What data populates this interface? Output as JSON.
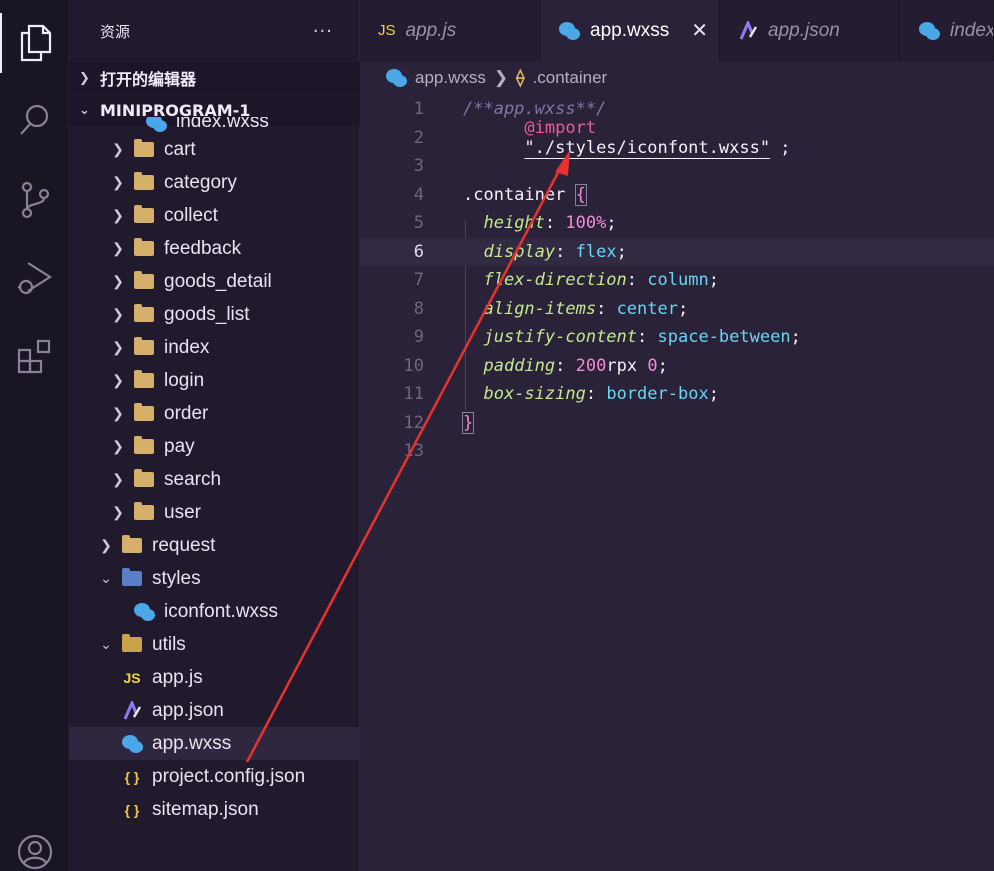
{
  "sidebar": {
    "title": "资源",
    "more": "···",
    "section_open_editors": "打开的编辑器",
    "section_project": "MINIPROGRAM-1",
    "partial_item": "index.wxss",
    "pages": [
      "cart",
      "category",
      "collect",
      "feedback",
      "goods_detail",
      "goods_list",
      "index",
      "login",
      "order",
      "pay",
      "search",
      "user"
    ],
    "request": "request",
    "styles": "styles",
    "iconfont": "iconfont.wxss",
    "utils": "utils",
    "appjs": "app.js",
    "appjson": "app.json",
    "appwxss": "app.wxss",
    "project_config": "project.config.json",
    "sitemap": "sitemap.json"
  },
  "tabs": [
    {
      "label": "app.js",
      "icon": "js-icon"
    },
    {
      "label": "app.wxss",
      "icon": "wechat-icon",
      "close": "✕"
    },
    {
      "label": "app.json",
      "icon": "json-icon"
    },
    {
      "label": "index",
      "icon": "wechat-icon"
    }
  ],
  "breadcrumb": {
    "file": "app.wxss",
    "symbol": ".container"
  },
  "editor": {
    "line_numbers": [
      "1",
      "2",
      "3",
      "4",
      "5",
      "6",
      "7",
      "8",
      "9",
      "10",
      "11",
      "12",
      "13"
    ],
    "comment": "/**app.wxss**/",
    "import_kw": "@import",
    "import_path": "\"./styles/iconfont.wxss\"",
    "semicolon": " ;",
    "selector": ".container ",
    "open_brace": "{",
    "close_brace": "}",
    "props": [
      {
        "name": "height",
        "value_num": "100",
        "value_unit": "%",
        "value": ""
      },
      {
        "name": "display",
        "value": "flex"
      },
      {
        "name": "flex-direction",
        "value": "column"
      },
      {
        "name": "align-items",
        "value": "center"
      },
      {
        "name": "justify-content",
        "value": "space-between"
      },
      {
        "name": "padding",
        "value_num": "200",
        "value_unit": "rpx",
        "value_tail": "0"
      },
      {
        "name": "box-sizing",
        "value": "border-box"
      }
    ]
  },
  "colors": {
    "accent_arrow": "#e8322f"
  }
}
